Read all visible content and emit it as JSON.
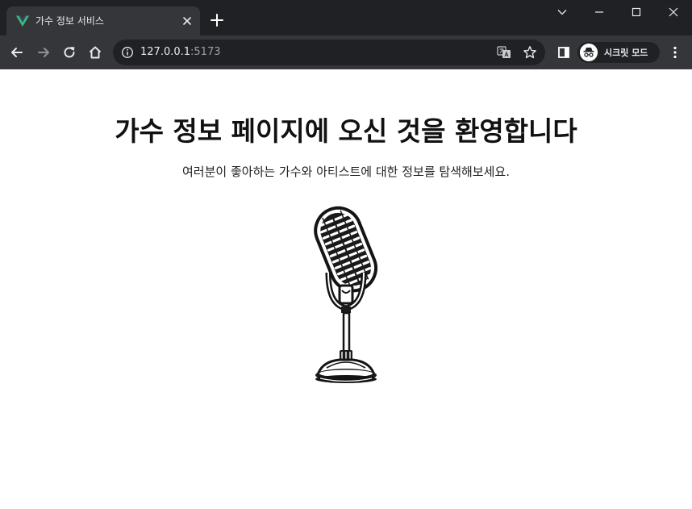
{
  "browser": {
    "tab": {
      "title": "가수 정보 서비스"
    },
    "address": {
      "host": "127.0.0.1",
      "port": ":5173"
    },
    "profile": {
      "label": "시크릿 모드"
    }
  },
  "page": {
    "heading": "가수 정보 페이지에 오신 것을 환영합니다",
    "subtext": "여러분이 좋아하는 가수와 아티스트에 대한 정보를 탐색해보세요."
  },
  "colors": {
    "titlebar": "#202124",
    "toolbar": "#35363a",
    "vue_green": "#41b883",
    "vue_dark": "#34495e"
  },
  "icons": [
    "vue-logo-icon",
    "close-icon",
    "plus-icon",
    "chevron-down-icon",
    "minimize-icon",
    "maximize-icon",
    "window-close-icon",
    "back-arrow-icon",
    "forward-arrow-icon",
    "reload-icon",
    "home-icon",
    "info-icon",
    "translate-icon",
    "star-icon",
    "side-panel-icon",
    "incognito-icon",
    "more-vert-icon",
    "microphone-icon"
  ]
}
